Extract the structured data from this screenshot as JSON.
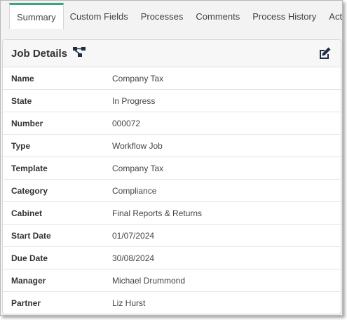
{
  "tabs": [
    {
      "label": "Summary",
      "active": true
    },
    {
      "label": "Custom Fields",
      "active": false
    },
    {
      "label": "Processes",
      "active": false
    },
    {
      "label": "Comments",
      "active": false
    },
    {
      "label": "Process History",
      "active": false
    },
    {
      "label": "Activity",
      "active": false
    }
  ],
  "panel": {
    "title": "Job Details",
    "title_icon": "workflow-icon",
    "edit_icon": "edit-icon"
  },
  "details": [
    {
      "label": "Name",
      "value": "Company Tax"
    },
    {
      "label": "State",
      "value": "In Progress"
    },
    {
      "label": "Number",
      "value": "000072"
    },
    {
      "label": "Type",
      "value": "Workflow Job"
    },
    {
      "label": "Template",
      "value": "Company Tax"
    },
    {
      "label": "Category",
      "value": "Compliance"
    },
    {
      "label": "Cabinet",
      "value": "Final Reports & Returns"
    },
    {
      "label": "Start Date",
      "value": "01/07/2024"
    },
    {
      "label": "Due Date",
      "value": "30/08/2024"
    },
    {
      "label": "Manager",
      "value": "Michael Drummond"
    },
    {
      "label": "Partner",
      "value": "Liz Hurst"
    }
  ],
  "colors": {
    "active_tab_accent": "#3ea37a",
    "icon": "#1f2d47"
  }
}
